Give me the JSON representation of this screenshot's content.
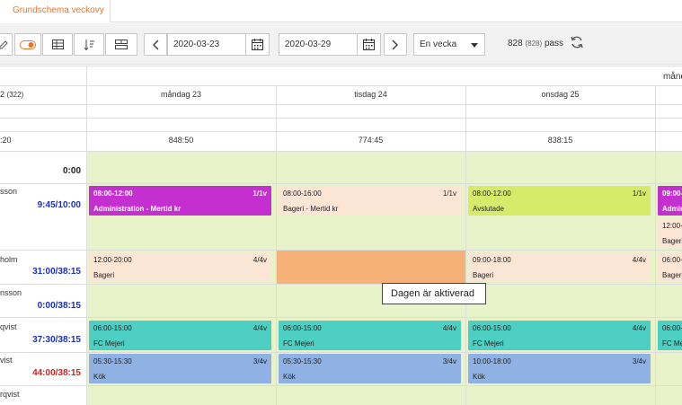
{
  "tabs": [
    {
      "label": "Grundschema veckovy"
    }
  ],
  "toolbar": {
    "date_from": "2020-03-23",
    "date_to": "2020-03-29",
    "period_select": "En vecka",
    "pass_count": "828",
    "pass_count_small": "(828)",
    "pass_label": "pass"
  },
  "header": {
    "week_label": "månd",
    "left_count": "2",
    "left_count_small": "(322)",
    "left_total": ":20",
    "days": [
      {
        "label": "måndag 23",
        "total": "848:50"
      },
      {
        "label": "tisdag 24",
        "total": "774:45"
      },
      {
        "label": "onsdag 25",
        "total": "838:15"
      }
    ]
  },
  "employees": [
    {
      "name": "",
      "hours": "0:00",
      "hours_color": "#222222"
    },
    {
      "name": "sson",
      "hours": "9:45/10:00",
      "hours_color": "#1a2fbf"
    },
    {
      "name": "holm",
      "hours": "31:00/38:15",
      "hours_color": "#1a2fbf"
    },
    {
      "name": "nsson",
      "hours": "0:00/38:15",
      "hours_color": "#1a2fbf"
    },
    {
      "name": "qvist",
      "hours": "37:30/38:15",
      "hours_color": "#1a2fbf"
    },
    {
      "name": "vist",
      "hours": "44:00/38:15",
      "hours_color": "#d0201a"
    },
    {
      "name": "rqvist",
      "hours": "",
      "hours_color": "#1a2fbf"
    }
  ],
  "shifts": {
    "r1": [
      {
        "time": "08:00-12:00",
        "count": "1/1v",
        "name": "Administration - Mertid kr",
        "color": "#c42fd0",
        "light": true
      },
      {
        "time": "08:00-16:00",
        "count": "1/1v",
        "name": "Bageri - Mertid kr",
        "color": "#fbe6d6",
        "light": false
      },
      {
        "time": "08:00-12:00",
        "count": "1/1v",
        "name": "Avslutade",
        "color": "#d7eb6b",
        "light": false
      }
    ],
    "r1_extra": [
      {
        "time": "09:00-",
        "name": "Admin",
        "color": "#c42fd0"
      },
      {
        "time": "12:00-",
        "name": "Bageri",
        "color": "#fbe6d6"
      }
    ],
    "r2": [
      {
        "time": "12:00-20:00",
        "count": "4/4v",
        "name": "Bageri",
        "color": "#fbe6d6",
        "light": false
      },
      {
        "time": "09:00-18:00",
        "count": "4/4v",
        "name": "Bageri",
        "color": "#fbe6d6",
        "light": false
      }
    ],
    "r2_extra": {
      "time": "06:00-",
      "name": "Bageri",
      "color": "#fbe6d6"
    },
    "r4": [
      {
        "time": "06:00-15:00",
        "count": "4/4v",
        "name": "FC Mejeri",
        "color": "#4ecfc4",
        "light": false
      },
      {
        "time": "06:00-15:00",
        "count": "4/4v",
        "name": "FC Mejeri",
        "color": "#4ecfc4",
        "light": false
      },
      {
        "time": "06:00-15:00",
        "count": "4/4v",
        "name": "FC Mejeri",
        "color": "#4ecfc4",
        "light": false
      }
    ],
    "r4_extra": {
      "time": "06:00-",
      "name": "FC Me",
      "color": "#4ecfc4"
    },
    "r5": [
      {
        "time": "05:30-15:30",
        "count": "3/4v",
        "name": "Kök",
        "color": "#8fb1e3",
        "light": false
      },
      {
        "time": "05:30-15:30",
        "count": "3/4v",
        "name": "Kök",
        "color": "#8fb1e3",
        "light": false
      },
      {
        "time": "10:00-18:00",
        "count": "3/4v",
        "name": "Kök",
        "color": "#8fb1e3",
        "light": false
      }
    ]
  },
  "activated_cell_color": "#f5b177",
  "tooltip": "Dagen är aktiverad"
}
